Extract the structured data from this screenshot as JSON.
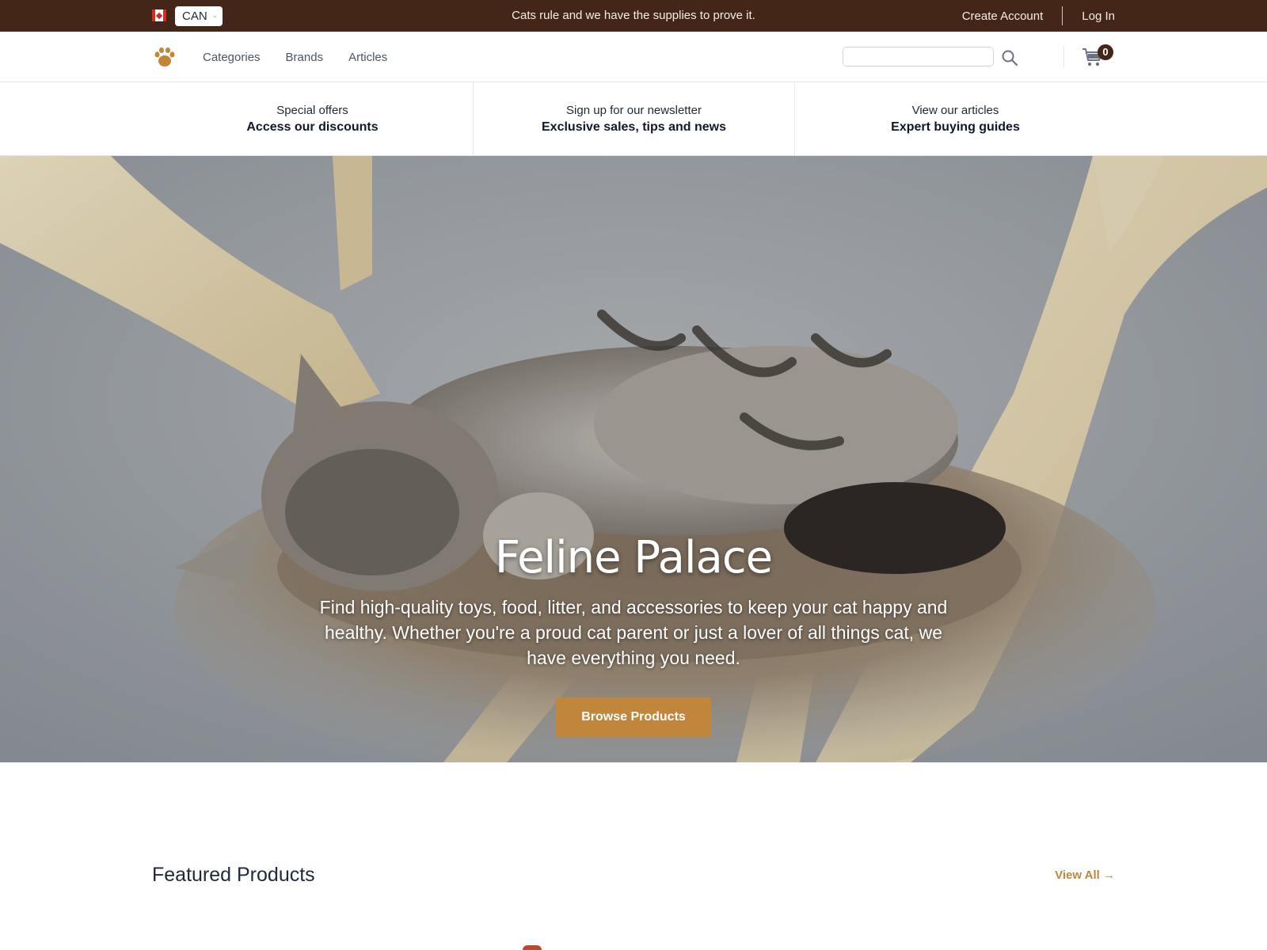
{
  "topbar": {
    "country": "CAN",
    "announcement": "Cats rule and we have the supplies to prove it.",
    "create_account": "Create Account",
    "log_in": "Log In"
  },
  "nav": {
    "items": [
      {
        "label": "Categories"
      },
      {
        "label": "Brands"
      },
      {
        "label": "Articles"
      }
    ],
    "search_placeholder": "",
    "cart_count": "0"
  },
  "promos": [
    {
      "small": "Special offers",
      "big": "Access our discounts"
    },
    {
      "small": "Sign up for our newsletter",
      "big": "Exclusive sales, tips and news"
    },
    {
      "small": "View our articles",
      "big": "Expert buying guides"
    }
  ],
  "hero": {
    "title": "Feline Palace",
    "description": "Find high-quality toys, food, litter, and accessories to keep your cat happy and healthy. Whether you're a proud cat parent or just a lover of all things cat, we have everything you need.",
    "button": "Browse Products"
  },
  "featured": {
    "title": "Featured Products",
    "view_all": "View All →"
  },
  "colors": {
    "topbar": "#442619",
    "accent": "#c2853c",
    "border": "#e5e7eb"
  },
  "icons": {
    "logo": "paw-icon",
    "search": "search-icon",
    "cart": "cart-icon",
    "flag": "canada-flag-icon",
    "chevron": "chevron-down-icon"
  }
}
